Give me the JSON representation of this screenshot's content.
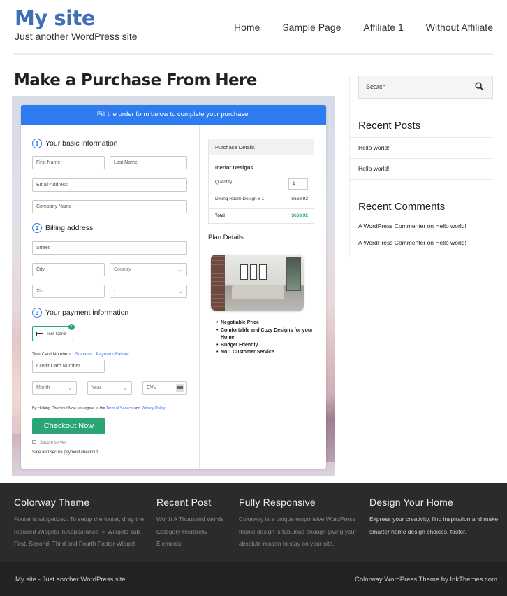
{
  "header": {
    "site_title": "My site",
    "tagline": "Just another WordPress site",
    "nav": [
      "Home",
      "Sample Page",
      "Affiliate 1",
      "Without Affiliate"
    ]
  },
  "main": {
    "page_title": "Make a Purchase From Here",
    "form": {
      "banner": "Fill the order form below to complete your purchase.",
      "basic_info_num": "1",
      "basic_info_title": "Your basic information",
      "first_name_ph": "First Name",
      "last_name_ph": "Last Name",
      "email_ph": "Email Address",
      "company_ph": "Company Name",
      "billing_num": "2",
      "billing_title": "Billing address",
      "street_ph": "Street",
      "city_ph": "City",
      "country_ph": "Country",
      "zip_ph": "Zip",
      "state_ph": "-",
      "payment_num": "3",
      "payment_title": "Your payment information",
      "test_card_label": "Test Card",
      "test_numbers_prefix": "Test Card Numbers : ",
      "test_success": "Success",
      "test_sep": " | ",
      "test_failure": "Payment Failure",
      "card_number_ph": "Credit Card Number",
      "month_ph": "Month",
      "year_ph": "Year",
      "cvv_ph": "CVV",
      "terms_prefix": "By clicking Checkout Now you agree to the ",
      "terms_link": "Term of Service",
      "terms_and": " and ",
      "privacy_link": "Privacy Policy",
      "checkout_label": "Checkout Now",
      "secure_server": "Secure server",
      "safe_checkout": "Safe and secure payment checkout."
    },
    "purchase": {
      "head": "Purchase Details",
      "product": "Inerior Designs",
      "quantity_label": "Quantity",
      "quantity_value": "1",
      "line_item": "Dining Room Design x 1",
      "line_price": "$668.92",
      "total_label": "Total",
      "total_value": "$668.92"
    },
    "plan": {
      "title": "Plan Details",
      "features": [
        "Negotiable Price",
        "Comfortable and Cozy Designs for your Home",
        "Budget Friendly",
        "No.1 Customer Service"
      ]
    }
  },
  "sidebar": {
    "search_ph": "Search",
    "recent_posts_title": "Recent Posts",
    "recent_posts": [
      "Hello world!",
      "Hello world!"
    ],
    "recent_comments_title": "Recent Comments",
    "comments": [
      {
        "author": "A WordPress Commenter",
        "on": " on ",
        "post": "Hello world!"
      },
      {
        "author": "A WordPress Commenter",
        "on": " on ",
        "post": "Hello world!"
      }
    ]
  },
  "footer": {
    "col1_title": "Colorway Theme",
    "col1_text": "Footer is widgetized. To setup the footer, drag the required Widgets in Appearance -> Widgets Tab First, Second, Third and Fourth Footer Widget",
    "col2_title": "Recent Post",
    "col2_items": [
      "Worth A Thousand Words",
      "Category Hierarchy",
      "Elements"
    ],
    "col3_title": "Fully Responsive",
    "col3_text": "Colorway is a unique responsive WordPress theme design is fabulous enough giving your absolute reason to stay on your site.",
    "col4_title": "Design Your Home",
    "col4_text": "Express your creativity, find inspiration and make smarter home design choices, faster.",
    "bottom_left": "My site - Just another WordPress site",
    "bottom_right": "Colorway WordPress Theme by InkThemes.com"
  },
  "colors": {
    "brand_blue": "#3f6fb6",
    "form_blue": "#2f7cf0",
    "green": "#2aa676"
  }
}
